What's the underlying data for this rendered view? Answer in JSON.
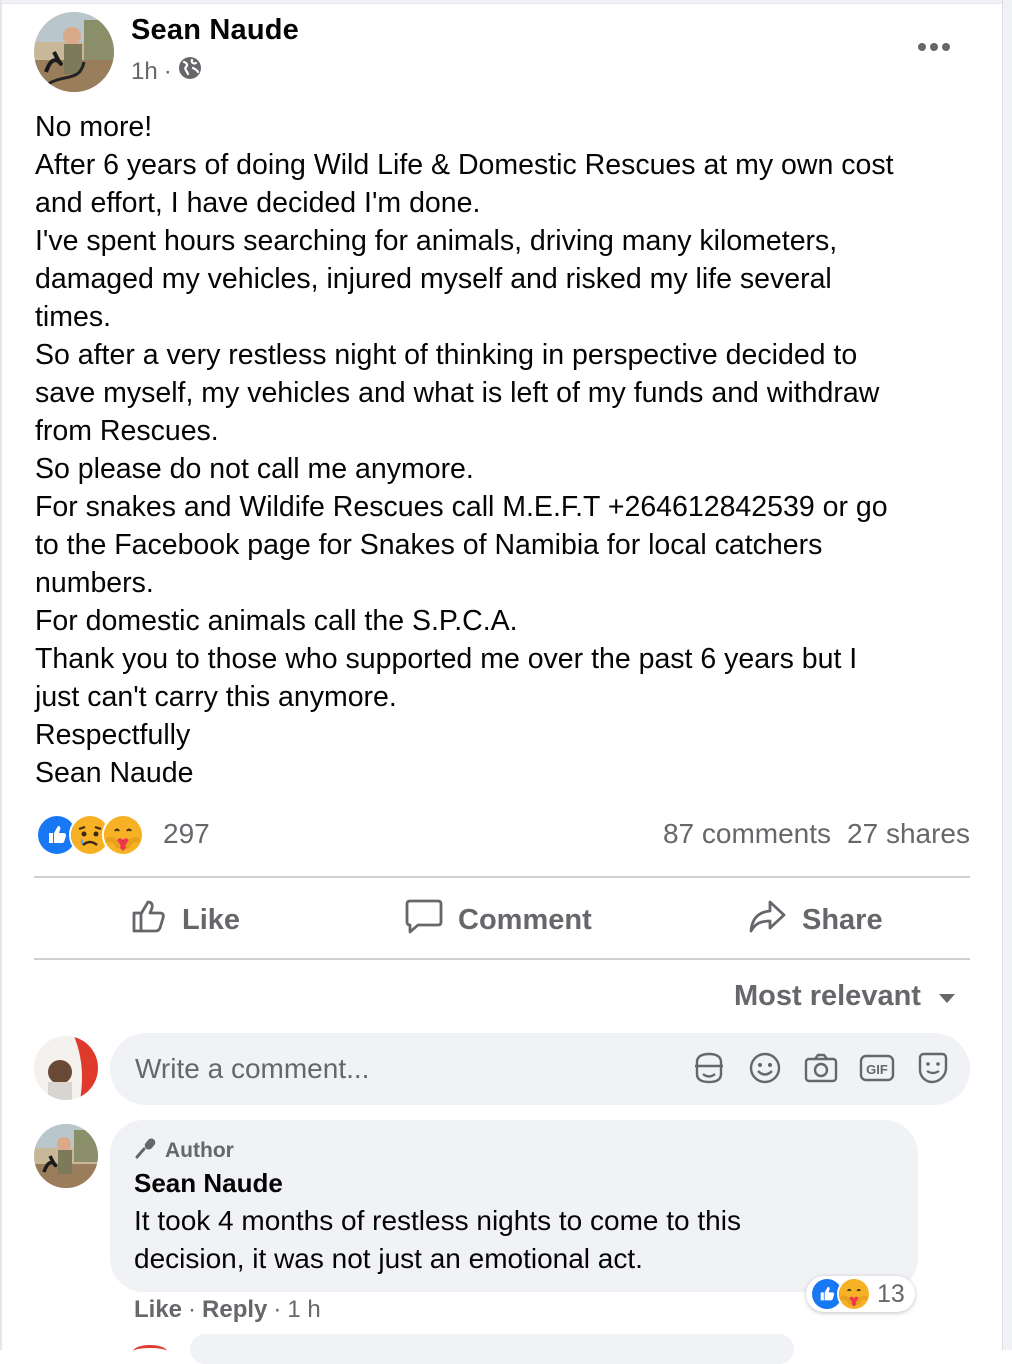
{
  "post": {
    "author": "Sean Naude",
    "time": "1h",
    "separator": "·",
    "privacy_icon": "globe-icon",
    "more_icon": "more-dots-icon",
    "lines": [
      "No more!",
      "After 6 years of doing Wild Life & Domestic Rescues at my own cost",
      "and effort, I have decided I'm done.",
      "I've spent hours searching for animals, driving many kilometers,",
      "damaged my vehicles, injured myself and risked my life several",
      "times.",
      "So after a very restless night of thinking in perspective decided to",
      "save myself, my vehicles and what is left of my funds and withdraw",
      "from Rescues.",
      "So please do not call me anymore.",
      "For snakes and Wildife Rescues call M.E.F.T +264612842539 or go",
      "to the Facebook page for Snakes of Namibia for local catchers",
      "numbers.",
      "For domestic animals call the S.P.C.A.",
      "Thank you to those who supported me over the past 6 years but I",
      "just can't carry this anymore.",
      "Respectfully",
      "Sean Naude"
    ],
    "reactions": {
      "icons": [
        "like-icon",
        "sad-icon",
        "care-icon"
      ],
      "count": "297"
    },
    "comments_count": "87 comments",
    "shares_count": "27 shares"
  },
  "actions": {
    "like": "Like",
    "comment": "Comment",
    "share": "Share"
  },
  "sort": {
    "label": "Most relevant"
  },
  "composer": {
    "placeholder": "Write a comment...",
    "icons": [
      "sticker-icon",
      "emoji-icon",
      "camera-icon",
      "gif-icon",
      "avatar-sticker-icon"
    ],
    "gif_text": "GIF"
  },
  "comment": {
    "badge": "Author",
    "author": "Sean Naude",
    "lines": [
      "It took 4 months of restless nights to come to this",
      "decision, it was not just an emotional act."
    ],
    "reactions": {
      "icons": [
        "like-icon",
        "care-icon"
      ],
      "count": "13"
    },
    "like": "Like",
    "dot": "·",
    "reply": "Reply",
    "time": "1 h"
  },
  "colors": {
    "secondary_text": "#65676b",
    "bubble": "#f0f2f5",
    "like_blue": "#1877f2",
    "divider": "#ced0d4"
  }
}
